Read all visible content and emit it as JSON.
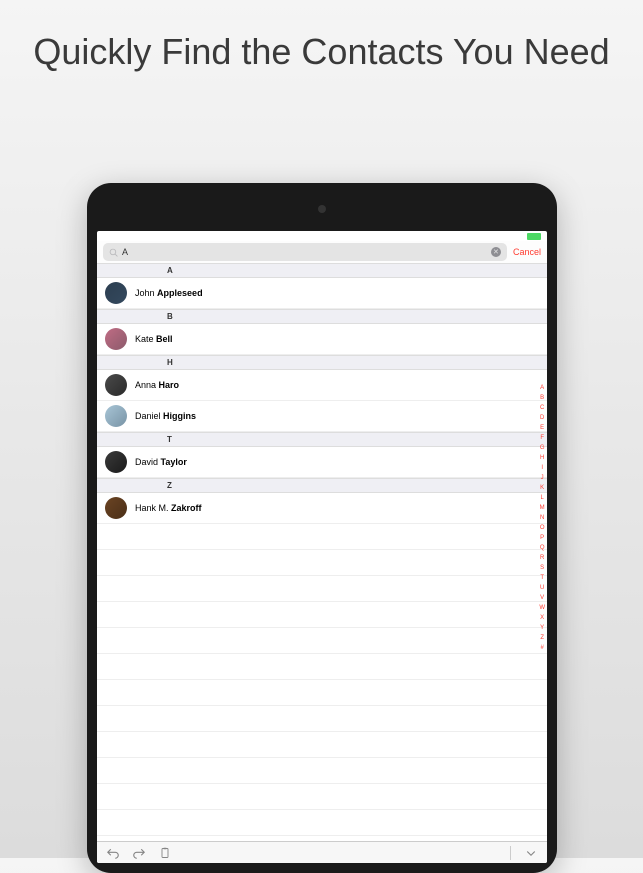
{
  "headline": "Quickly Find the Contacts You Need",
  "search": {
    "value": "A",
    "cancel": "Cancel"
  },
  "sections": [
    {
      "letter": "A",
      "contacts": [
        {
          "first": "John",
          "last": "Appleseed"
        }
      ]
    },
    {
      "letter": "B",
      "contacts": [
        {
          "first": "Kate",
          "last": "Bell"
        }
      ]
    },
    {
      "letter": "H",
      "contacts": [
        {
          "first": "Anna",
          "last": "Haro"
        },
        {
          "first": "Daniel",
          "last": "Higgins"
        }
      ]
    },
    {
      "letter": "T",
      "contacts": [
        {
          "first": "David",
          "last": "Taylor"
        }
      ]
    },
    {
      "letter": "Z",
      "contacts": [
        {
          "first": "Hank M.",
          "last": "Zakroff"
        }
      ]
    }
  ],
  "index": [
    "A",
    "B",
    "C",
    "D",
    "E",
    "F",
    "G",
    "H",
    "I",
    "J",
    "K",
    "L",
    "M",
    "N",
    "O",
    "P",
    "Q",
    "R",
    "S",
    "T",
    "U",
    "V",
    "W",
    "X",
    "Y",
    "Z",
    "#"
  ]
}
